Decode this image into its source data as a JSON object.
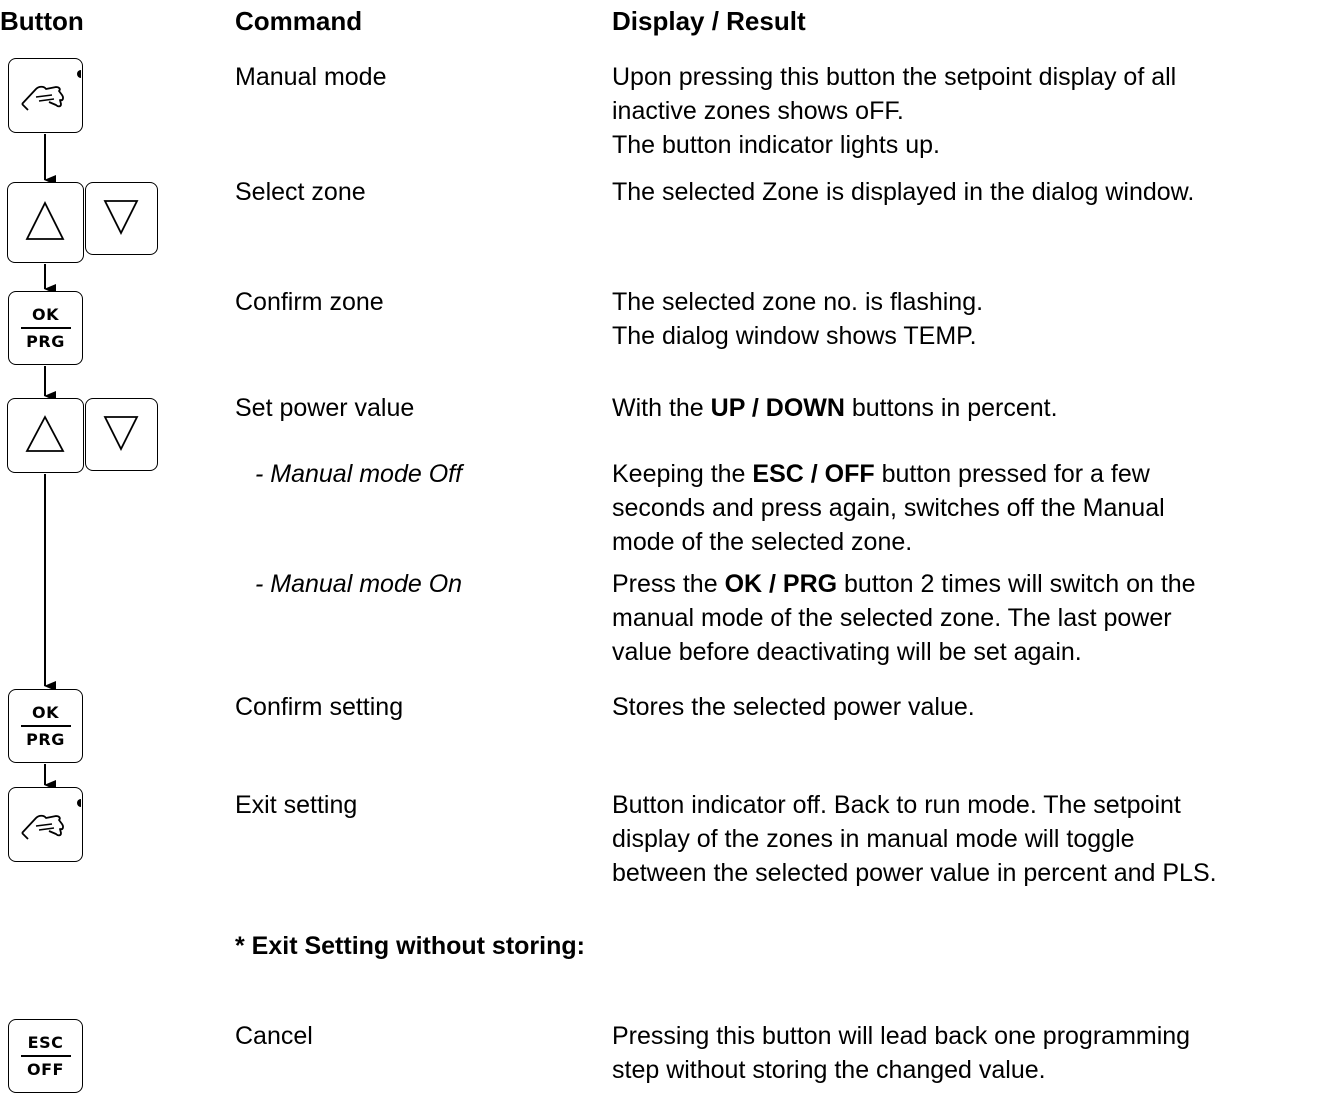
{
  "headers": {
    "button": "Button",
    "command": "Command",
    "result": "Display / Result"
  },
  "rows": [
    {
      "command": "Manual mode",
      "result_lines": [
        "Upon pressing this button the setpoint display of all",
        "inactive zones shows oFF.",
        "The button indicator lights up."
      ]
    },
    {
      "command": "Select zone",
      "result_lines": [
        "The selected Zone is displayed in the dialog window."
      ]
    },
    {
      "command": "Confirm zone",
      "result_lines": [
        "The selected zone no. is flashing.",
        "The dialog window shows TEMP."
      ]
    },
    {
      "command": "Set power value",
      "result": {
        "pre": "With the ",
        "bold": "UP / DOWN",
        "post": " buttons in percent."
      }
    },
    {
      "command": "- Manual mode Off",
      "result": {
        "pre": "Keeping the ",
        "bold": "ESC / OFF",
        "post": " button pressed for a few"
      },
      "result_more": [
        "seconds and press again, switches off the Manual",
        "mode of the selected zone."
      ]
    },
    {
      "command": "- Manual mode On",
      "result": {
        "pre": "Press the ",
        "bold": "OK / PRG",
        "post": " button 2 times will switch on the"
      },
      "result_more": [
        "manual mode of the selected zone. The last power",
        "value before deactivating will be set again."
      ]
    },
    {
      "command": "Confirm setting",
      "result_lines": [
        "Stores the selected power value."
      ]
    },
    {
      "command": "Exit setting",
      "result_lines": [
        "Button indicator off. Back to run mode. The setpoint",
        "display of the zones in manual mode will toggle",
        "between the selected power value in percent and PLS."
      ]
    }
  ],
  "section_title": "* Exit Setting without storing:",
  "cancel": {
    "command": "Cancel",
    "result_lines": [
      "Pressing this button will lead back one programming",
      "step without storing the changed value."
    ]
  },
  "keys": {
    "ok": "OK",
    "prg": "PRG",
    "esc": "ESC",
    "off": "OFF",
    "hand_icon": "hand-icon",
    "up_icon": "triangle-up-icon",
    "down_icon": "triangle-down-icon"
  }
}
